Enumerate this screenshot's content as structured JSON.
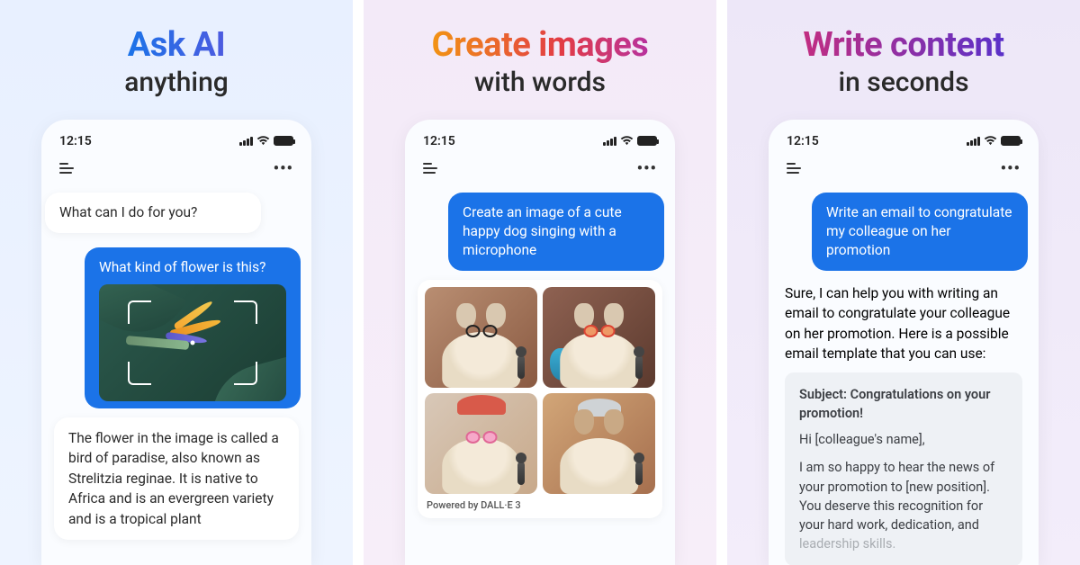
{
  "panels": [
    {
      "title_main": "Ask AI",
      "title_sub": "anything",
      "phone": {
        "time": "12:15",
        "assistant_intro": "What can I do for you?",
        "user_prompt": "What kind of flower is this?",
        "assistant_answer": "The flower in the image is called a bird of paradise, also known as Strelitzia reginae. It is native to Africa and is an evergreen variety and is a tropical plant"
      }
    },
    {
      "title_main": "Create images",
      "title_sub": "with words",
      "phone": {
        "time": "12:15",
        "user_prompt": "Create an image of a cute happy dog singing with a microphone",
        "powered_by": "Powered by DALL·E 3"
      }
    },
    {
      "title_main": "Write content",
      "title_sub": "in seconds",
      "phone": {
        "time": "12:15",
        "user_prompt": "Write an email to congratulate my colleague on her promotion",
        "assistant_intro": "Sure, I can help you with writing an email to congratulate your colleague on her promotion. Here is a possible email template that you can use:",
        "email": {
          "subject": "Subject: Congratulations on your promotion!",
          "greeting": "Hi [colleague's name],",
          "body_visible": "I am so happy to hear the news of your promotion to [new position]. You deserve this recognition for your hard work, dedication, and ",
          "body_faded": "leadership skills."
        }
      }
    }
  ]
}
